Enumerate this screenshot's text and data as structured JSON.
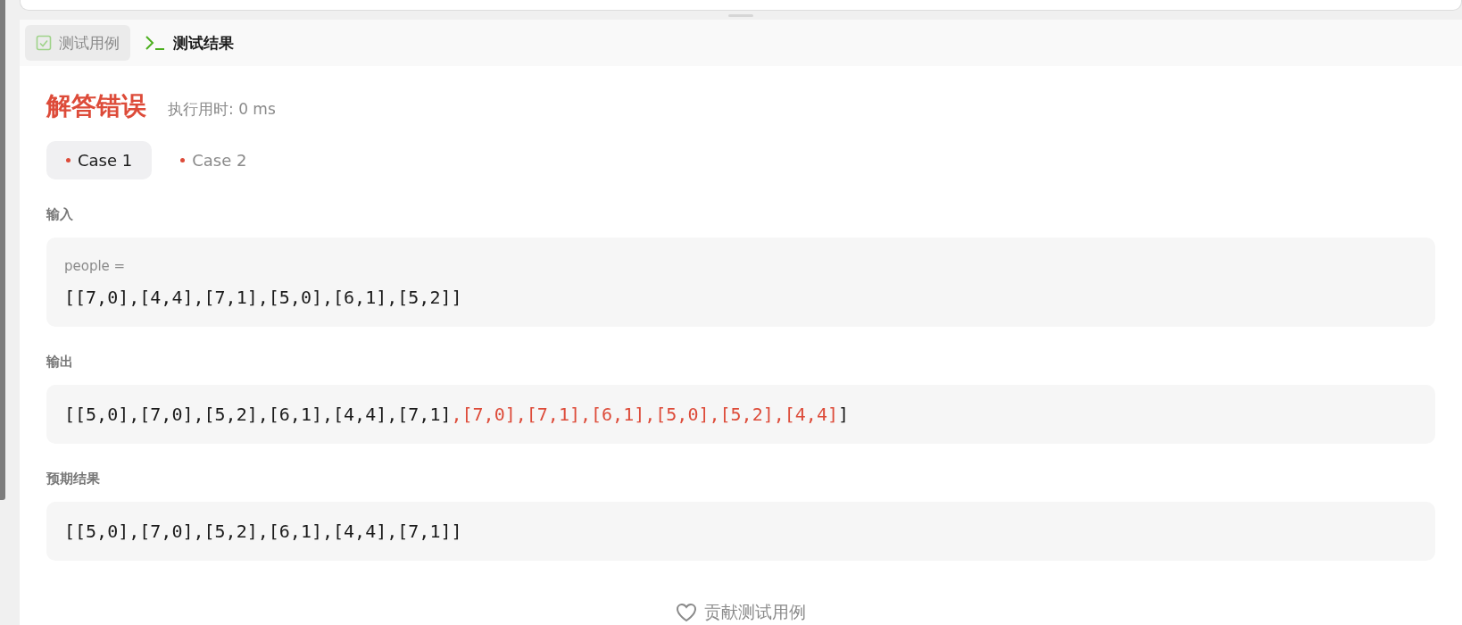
{
  "tabs": [
    {
      "label": "测试用例",
      "kind": "testcase",
      "selected": false
    },
    {
      "label": "测试结果",
      "kind": "result",
      "selected": true
    }
  ],
  "result": {
    "kind": "wrong",
    "title": "解答错误",
    "runtime": "执行用时: 0 ms"
  },
  "cases": [
    {
      "label": "Case 1",
      "passed": false,
      "selected": true
    },
    {
      "label": "Case 2",
      "passed": false,
      "selected": false
    }
  ],
  "input": {
    "label": "输入",
    "param": "people =",
    "value": "[[7,0],[4,4],[7,1],[5,0],[6,1],[5,2]]"
  },
  "output": {
    "label": "输出",
    "segments": [
      {
        "text": "[[5,0],[7,0],[5,2],[6,1],[4,4],[7,1]",
        "mismatch": false
      },
      {
        "text": ",[7,0],[7,1],[6,1],[5,0],[5,2],[4,4]",
        "mismatch": true
      },
      {
        "text": "]",
        "mismatch": false
      }
    ]
  },
  "expected": {
    "label": "预期结果",
    "value": "[[5,0],[7,0],[5,2],[6,1],[4,4],[7,1]]"
  },
  "contribute_button": {
    "label": "贡献测试用例"
  }
}
